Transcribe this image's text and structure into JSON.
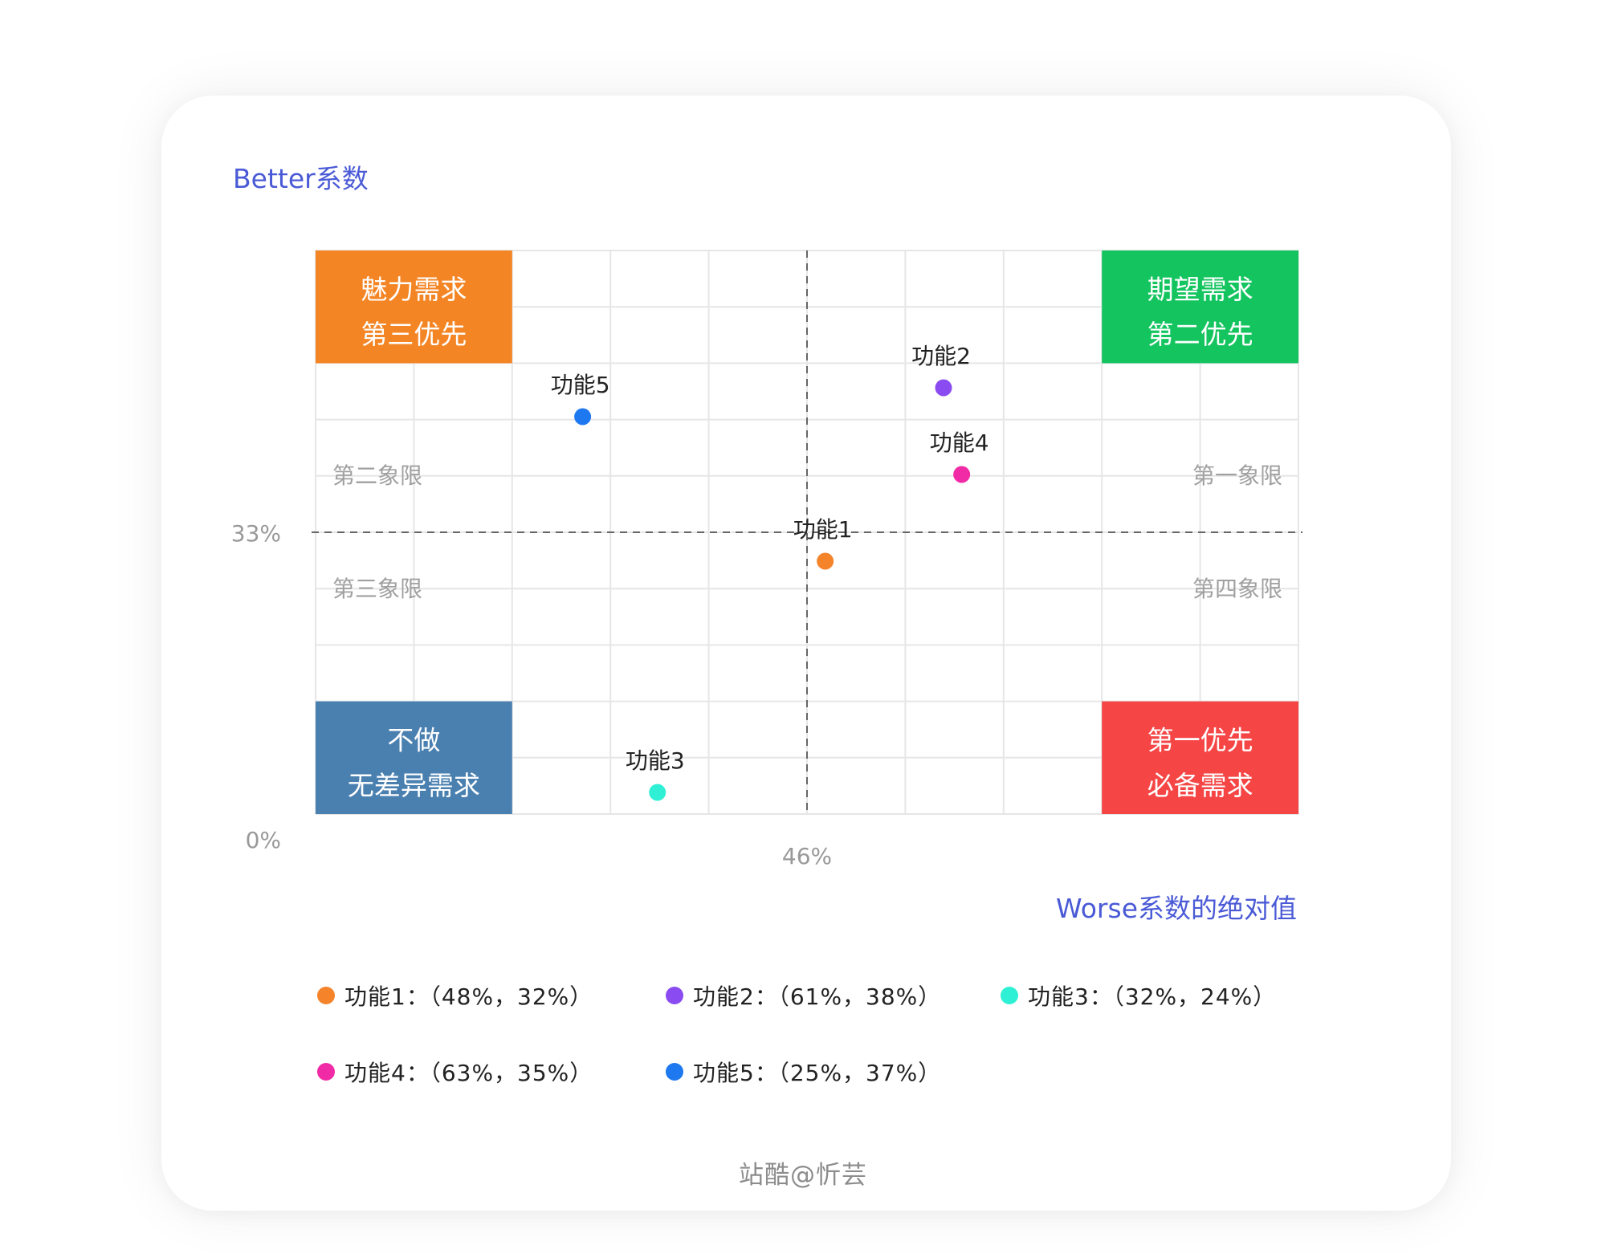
{
  "chart_data": {
    "type": "scatter",
    "ylabel": "Better系数",
    "xlabel": "Worse系数的绝对值",
    "x_divider": {
      "value": 46,
      "label": "46%"
    },
    "y_divider": {
      "value": 33,
      "label": "33%"
    },
    "y_origin_label": "0%",
    "xlim": [
      0,
      100
    ],
    "ylim": [
      0,
      100
    ],
    "grid": true,
    "points": [
      {
        "name": "功能1",
        "x": 48,
        "y": 32,
        "color": "#f5832a"
      },
      {
        "name": "功能2",
        "x": 61,
        "y": 38,
        "color": "#8a4cf0"
      },
      {
        "name": "功能3",
        "x": 32,
        "y": 24,
        "color": "#2ff0d4"
      },
      {
        "name": "功能4",
        "x": 63,
        "y": 35,
        "color": "#f02ba5"
      },
      {
        "name": "功能5",
        "x": 25,
        "y": 37,
        "color": "#1e78f0"
      }
    ],
    "quadrant_labels": {
      "q1": "第一象限",
      "q2": "第二象限",
      "q3": "第三象限",
      "q4": "第四象限"
    },
    "corner_boxes": [
      {
        "corner": "top-left",
        "line1": "魅力需求",
        "line2": "第三优先",
        "color": "#f48524"
      },
      {
        "corner": "top-right",
        "line1": "期望需求",
        "line2": "第二优先",
        "color": "#14c45f"
      },
      {
        "corner": "bottom-left",
        "line1": "不做",
        "line2": "无差异需求",
        "color": "#4a80b0"
      },
      {
        "corner": "bottom-right",
        "line1": "第一优先",
        "line2": "必备需求",
        "color": "#f54545"
      }
    ],
    "legend_placement": "bottom"
  },
  "legend": {
    "items": [
      {
        "text": "功能1：（48%，32%）",
        "color": "#f5832a"
      },
      {
        "text": "功能2：（61%，38%）",
        "color": "#8a4cf0"
      },
      {
        "text": "功能3：（32%，24%）",
        "color": "#2ff0d4"
      },
      {
        "text": "功能4：（63%，35%）",
        "color": "#f02ba5"
      },
      {
        "text": "功能5：（25%，37%）",
        "color": "#1e78f0"
      }
    ]
  },
  "watermark": "站酷@忻芸"
}
